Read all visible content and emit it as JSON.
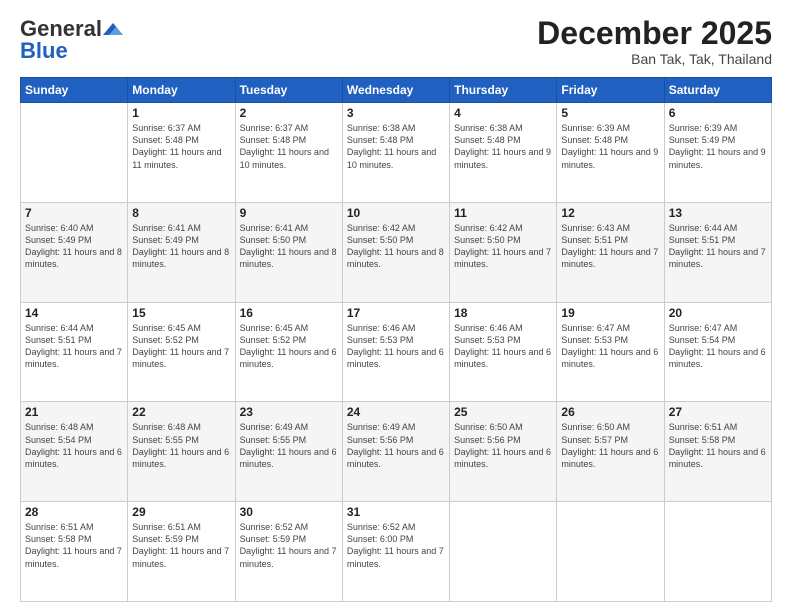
{
  "header": {
    "logo_general": "General",
    "logo_blue": "Blue",
    "month_title": "December 2025",
    "location": "Ban Tak, Tak, Thailand"
  },
  "weekdays": [
    "Sunday",
    "Monday",
    "Tuesday",
    "Wednesday",
    "Thursday",
    "Friday",
    "Saturday"
  ],
  "weeks": [
    [
      {
        "day": "",
        "sunrise": "",
        "sunset": "",
        "daylight": ""
      },
      {
        "day": "1",
        "sunrise": "Sunrise: 6:37 AM",
        "sunset": "Sunset: 5:48 PM",
        "daylight": "Daylight: 11 hours and 11 minutes."
      },
      {
        "day": "2",
        "sunrise": "Sunrise: 6:37 AM",
        "sunset": "Sunset: 5:48 PM",
        "daylight": "Daylight: 11 hours and 10 minutes."
      },
      {
        "day": "3",
        "sunrise": "Sunrise: 6:38 AM",
        "sunset": "Sunset: 5:48 PM",
        "daylight": "Daylight: 11 hours and 10 minutes."
      },
      {
        "day": "4",
        "sunrise": "Sunrise: 6:38 AM",
        "sunset": "Sunset: 5:48 PM",
        "daylight": "Daylight: 11 hours and 9 minutes."
      },
      {
        "day": "5",
        "sunrise": "Sunrise: 6:39 AM",
        "sunset": "Sunset: 5:48 PM",
        "daylight": "Daylight: 11 hours and 9 minutes."
      },
      {
        "day": "6",
        "sunrise": "Sunrise: 6:39 AM",
        "sunset": "Sunset: 5:49 PM",
        "daylight": "Daylight: 11 hours and 9 minutes."
      }
    ],
    [
      {
        "day": "7",
        "sunrise": "Sunrise: 6:40 AM",
        "sunset": "Sunset: 5:49 PM",
        "daylight": "Daylight: 11 hours and 8 minutes."
      },
      {
        "day": "8",
        "sunrise": "Sunrise: 6:41 AM",
        "sunset": "Sunset: 5:49 PM",
        "daylight": "Daylight: 11 hours and 8 minutes."
      },
      {
        "day": "9",
        "sunrise": "Sunrise: 6:41 AM",
        "sunset": "Sunset: 5:50 PM",
        "daylight": "Daylight: 11 hours and 8 minutes."
      },
      {
        "day": "10",
        "sunrise": "Sunrise: 6:42 AM",
        "sunset": "Sunset: 5:50 PM",
        "daylight": "Daylight: 11 hours and 8 minutes."
      },
      {
        "day": "11",
        "sunrise": "Sunrise: 6:42 AM",
        "sunset": "Sunset: 5:50 PM",
        "daylight": "Daylight: 11 hours and 7 minutes."
      },
      {
        "day": "12",
        "sunrise": "Sunrise: 6:43 AM",
        "sunset": "Sunset: 5:51 PM",
        "daylight": "Daylight: 11 hours and 7 minutes."
      },
      {
        "day": "13",
        "sunrise": "Sunrise: 6:44 AM",
        "sunset": "Sunset: 5:51 PM",
        "daylight": "Daylight: 11 hours and 7 minutes."
      }
    ],
    [
      {
        "day": "14",
        "sunrise": "Sunrise: 6:44 AM",
        "sunset": "Sunset: 5:51 PM",
        "daylight": "Daylight: 11 hours and 7 minutes."
      },
      {
        "day": "15",
        "sunrise": "Sunrise: 6:45 AM",
        "sunset": "Sunset: 5:52 PM",
        "daylight": "Daylight: 11 hours and 7 minutes."
      },
      {
        "day": "16",
        "sunrise": "Sunrise: 6:45 AM",
        "sunset": "Sunset: 5:52 PM",
        "daylight": "Daylight: 11 hours and 6 minutes."
      },
      {
        "day": "17",
        "sunrise": "Sunrise: 6:46 AM",
        "sunset": "Sunset: 5:53 PM",
        "daylight": "Daylight: 11 hours and 6 minutes."
      },
      {
        "day": "18",
        "sunrise": "Sunrise: 6:46 AM",
        "sunset": "Sunset: 5:53 PM",
        "daylight": "Daylight: 11 hours and 6 minutes."
      },
      {
        "day": "19",
        "sunrise": "Sunrise: 6:47 AM",
        "sunset": "Sunset: 5:53 PM",
        "daylight": "Daylight: 11 hours and 6 minutes."
      },
      {
        "day": "20",
        "sunrise": "Sunrise: 6:47 AM",
        "sunset": "Sunset: 5:54 PM",
        "daylight": "Daylight: 11 hours and 6 minutes."
      }
    ],
    [
      {
        "day": "21",
        "sunrise": "Sunrise: 6:48 AM",
        "sunset": "Sunset: 5:54 PM",
        "daylight": "Daylight: 11 hours and 6 minutes."
      },
      {
        "day": "22",
        "sunrise": "Sunrise: 6:48 AM",
        "sunset": "Sunset: 5:55 PM",
        "daylight": "Daylight: 11 hours and 6 minutes."
      },
      {
        "day": "23",
        "sunrise": "Sunrise: 6:49 AM",
        "sunset": "Sunset: 5:55 PM",
        "daylight": "Daylight: 11 hours and 6 minutes."
      },
      {
        "day": "24",
        "sunrise": "Sunrise: 6:49 AM",
        "sunset": "Sunset: 5:56 PM",
        "daylight": "Daylight: 11 hours and 6 minutes."
      },
      {
        "day": "25",
        "sunrise": "Sunrise: 6:50 AM",
        "sunset": "Sunset: 5:56 PM",
        "daylight": "Daylight: 11 hours and 6 minutes."
      },
      {
        "day": "26",
        "sunrise": "Sunrise: 6:50 AM",
        "sunset": "Sunset: 5:57 PM",
        "daylight": "Daylight: 11 hours and 6 minutes."
      },
      {
        "day": "27",
        "sunrise": "Sunrise: 6:51 AM",
        "sunset": "Sunset: 5:58 PM",
        "daylight": "Daylight: 11 hours and 6 minutes."
      }
    ],
    [
      {
        "day": "28",
        "sunrise": "Sunrise: 6:51 AM",
        "sunset": "Sunset: 5:58 PM",
        "daylight": "Daylight: 11 hours and 7 minutes."
      },
      {
        "day": "29",
        "sunrise": "Sunrise: 6:51 AM",
        "sunset": "Sunset: 5:59 PM",
        "daylight": "Daylight: 11 hours and 7 minutes."
      },
      {
        "day": "30",
        "sunrise": "Sunrise: 6:52 AM",
        "sunset": "Sunset: 5:59 PM",
        "daylight": "Daylight: 11 hours and 7 minutes."
      },
      {
        "day": "31",
        "sunrise": "Sunrise: 6:52 AM",
        "sunset": "Sunset: 6:00 PM",
        "daylight": "Daylight: 11 hours and 7 minutes."
      },
      {
        "day": "",
        "sunrise": "",
        "sunset": "",
        "daylight": ""
      },
      {
        "day": "",
        "sunrise": "",
        "sunset": "",
        "daylight": ""
      },
      {
        "day": "",
        "sunrise": "",
        "sunset": "",
        "daylight": ""
      }
    ]
  ]
}
